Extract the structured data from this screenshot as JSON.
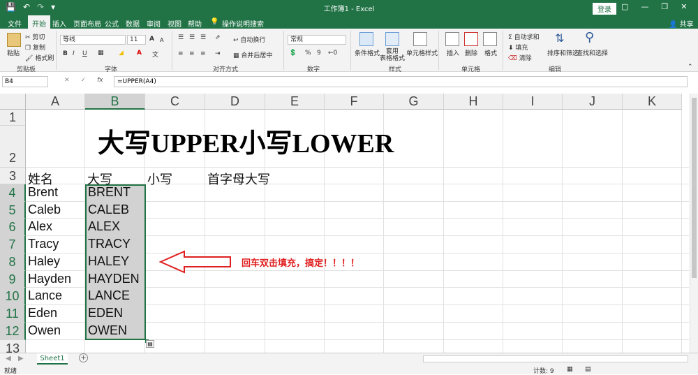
{
  "titlebar": {
    "title": "工作簿1  -  Excel",
    "login": "登录",
    "quick_access": [
      "save-icon",
      "undo-icon",
      "redo-icon",
      "customize-icon"
    ]
  },
  "menu": {
    "tabs": [
      "文件",
      "开始",
      "插入",
      "页面布局",
      "公式",
      "数据",
      "审阅",
      "视图",
      "帮助"
    ],
    "tell_me": "操作说明搜索",
    "share": "共享"
  },
  "ribbon": {
    "clipboard": {
      "paste": "粘贴",
      "cut": "剪切",
      "copy": "复制",
      "format_painter": "格式刷",
      "label": "剪贴板"
    },
    "font": {
      "name": "等线",
      "size": "11",
      "bold": "B",
      "italic": "I",
      "underline": "U",
      "grow": "A",
      "shrink": "A",
      "label": "字体"
    },
    "alignment": {
      "wrap": "自动换行",
      "merge": "合并后居中",
      "label": "对齐方式"
    },
    "number": {
      "format": "常规",
      "percent": "%",
      "comma": "9",
      "label": "数字"
    },
    "styles": {
      "conditional": "条件格式",
      "table_format": "套用\n表格格式",
      "cell_styles": "单元格样式",
      "label": "样式"
    },
    "cells": {
      "insert": "插入",
      "delete": "删除",
      "format": "格式",
      "label": "单元格"
    },
    "editing": {
      "autosum": "自动求和",
      "fill": "填充",
      "clear": "清除",
      "sort": "排序和筛选",
      "find": "查找和选择",
      "label": "编辑"
    }
  },
  "formula_bar": {
    "name_box": "B4",
    "cancel": "✕",
    "enter": "✓",
    "fx": "fx",
    "formula": "=UPPER(A4)"
  },
  "columns": [
    "A",
    "B",
    "C",
    "D",
    "E",
    "F",
    "G",
    "H",
    "I",
    "J",
    "K"
  ],
  "rows": [
    "1",
    "2",
    "3",
    "4",
    "5",
    "6",
    "7",
    "8",
    "9",
    "10",
    "11",
    "12",
    "13"
  ],
  "sheet_title": "大写UPPER小写LOWER",
  "headers": {
    "a": "姓名",
    "b": "大写",
    "c": "小写",
    "d": "首字母大写"
  },
  "names": [
    "Brent",
    "Caleb",
    "Alex",
    "Tracy",
    "Haley",
    "Hayden",
    "Lance",
    "Eden",
    "Owen"
  ],
  "upper": [
    "BRENT",
    "CALEB",
    "ALEX",
    "TRACY",
    "HALEY",
    "HAYDEN",
    "LANCE",
    "EDEN",
    "OWEN"
  ],
  "annotation": "回车双击填充，搞定！！！！",
  "sheet_tabs": {
    "active": "Sheet1",
    "add": "+"
  },
  "status": {
    "ready": "就绪",
    "count": "计数: 9"
  },
  "colors": {
    "accent": "#217346",
    "annotation": "#e02020"
  }
}
